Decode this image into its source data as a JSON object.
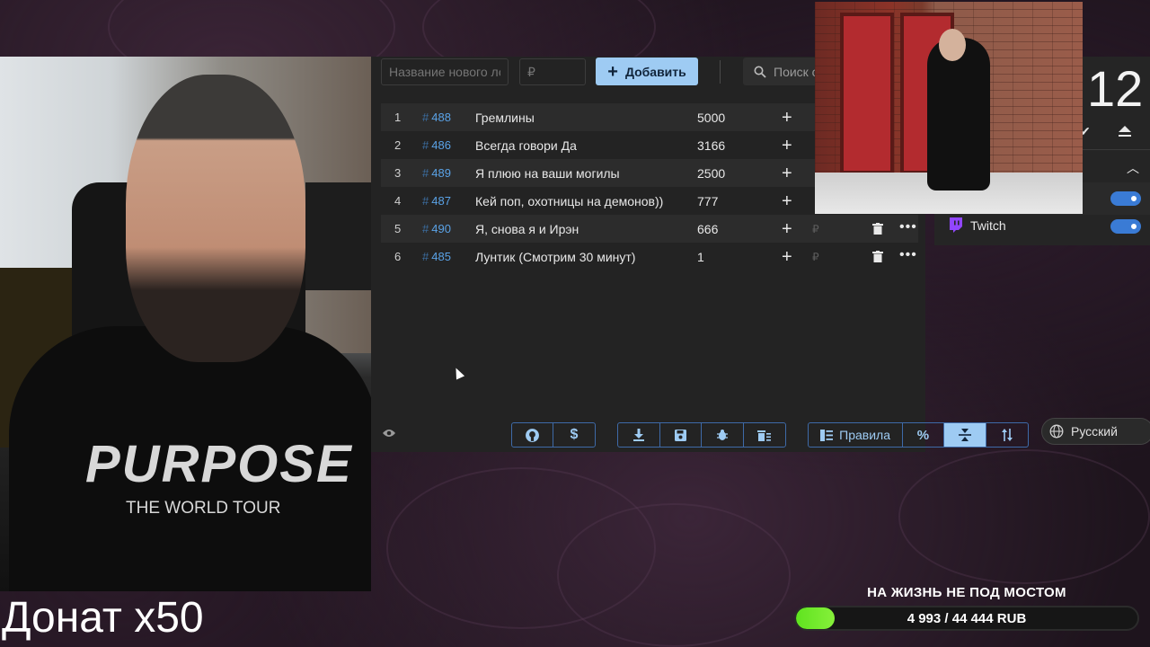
{
  "add_form": {
    "name_placeholder": "Название нового ло",
    "price_placeholder": "₽",
    "add_label": "Добавить",
    "search_placeholder": "Поиск с"
  },
  "lots": [
    {
      "index": "1",
      "id": "488",
      "title": "Гремлины",
      "amount": "5000"
    },
    {
      "index": "2",
      "id": "486",
      "title": "Всегда говори Да",
      "amount": "3166"
    },
    {
      "index": "3",
      "id": "489",
      "title": "Я плюю на ваши могилы",
      "amount": "2500"
    },
    {
      "index": "4",
      "id": "487",
      "title": "Кей поп, охотницы на демонов))",
      "amount": "777"
    },
    {
      "index": "5",
      "id": "490",
      "title": "Я, снова я и Ирэн",
      "amount": "666"
    },
    {
      "index": "6",
      "id": "485",
      "title": "Лунтик (Смотрим 30 минут)",
      "amount": "1"
    }
  ],
  "row_currency": "₽",
  "bottom_toolbar": {
    "rules_label": "Правила",
    "language": "Русский"
  },
  "side_panel": {
    "timer_fragment": "12",
    "twitch_label": "Twitch"
  },
  "donation_goal": {
    "title": "НА ЖИЗНЬ НЕ ПОД МОСТОМ",
    "progress_text": "4 993 / 44 444 RUB",
    "current": 4993,
    "target": 44444
  },
  "overlay_label": "Донат x50",
  "webcam": {
    "shirt_line1": "PURPOSE",
    "shirt_line2": "THE WORLD TOUR"
  },
  "colors": {
    "accent": "#9ecbf3",
    "lot_id": "#5aa2e6",
    "progress": "#5fe31f",
    "toggle": "#3a7bd5"
  }
}
